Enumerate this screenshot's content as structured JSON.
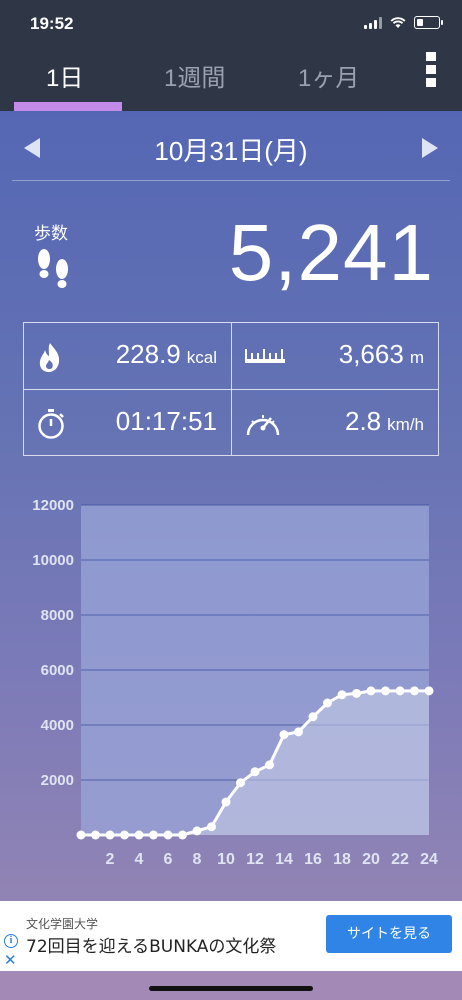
{
  "status": {
    "time": "19:52"
  },
  "tabs": [
    {
      "label": "1日",
      "active": true
    },
    {
      "label": "1週間",
      "active": false
    },
    {
      "label": "1ヶ月",
      "active": false
    }
  ],
  "date": {
    "label": "10月31日(月)"
  },
  "steps": {
    "label": "歩数",
    "value": "5,241"
  },
  "stats": {
    "calories": {
      "value": "228.9",
      "unit": "kcal",
      "icon": "flame-icon"
    },
    "distance": {
      "value": "3,663",
      "unit": "m",
      "icon": "ruler-icon"
    },
    "duration": {
      "value": "01:17:51",
      "icon": "stopwatch-icon"
    },
    "speed": {
      "value": "2.8",
      "unit": "km/h",
      "icon": "speedometer-icon"
    }
  },
  "chart_data": {
    "type": "area",
    "x": [
      0,
      1,
      2,
      3,
      4,
      5,
      6,
      7,
      8,
      9,
      10,
      11,
      12,
      13,
      14,
      15,
      16,
      17,
      18,
      19,
      20,
      21,
      22,
      23,
      24
    ],
    "values": [
      0,
      0,
      0,
      0,
      0,
      0,
      0,
      0,
      150,
      300,
      1200,
      1900,
      2300,
      2550,
      3650,
      3750,
      4300,
      4800,
      5100,
      5150,
      5241,
      5241,
      5241,
      5241,
      5241
    ],
    "xticks": [
      "2",
      "4",
      "6",
      "8",
      "10",
      "12",
      "14",
      "16",
      "18",
      "20",
      "22",
      "24"
    ],
    "yticks": [
      "2000",
      "4000",
      "6000",
      "8000",
      "10000",
      "12000"
    ],
    "ylim": [
      0,
      12000
    ],
    "xlim": [
      0,
      24
    ],
    "grid": true,
    "colors": {
      "line": "#ffffff",
      "fill": "#c8cde6",
      "gridline": "#3a4ea0",
      "plot_bg": "#9aa6d8"
    }
  },
  "ad": {
    "subtitle": "文化学園大学",
    "title": "72回目を迎えるBUNKAの文化祭",
    "button": "サイトを見る"
  }
}
